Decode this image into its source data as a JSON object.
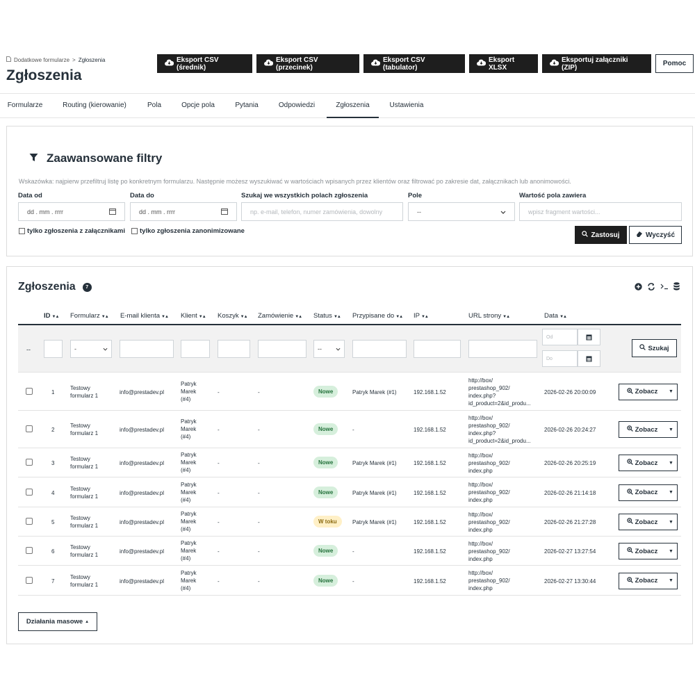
{
  "header": {
    "breadcrumb_parent": "Dodatkowe formularze",
    "breadcrumb_sep": ">",
    "breadcrumb_current": "Zgłoszenia",
    "title": "Zgłoszenia"
  },
  "toolbar": {
    "csv_avg": "Eksport CSV (średnik)",
    "csv_comma": "Eksport CSV (przecinek)",
    "csv_tab": "Eksport CSV (tabulator)",
    "xlsx": "Eksport XLSX",
    "zip": "Eksportuj załączniki (ZIP)",
    "help": "Pomoc"
  },
  "tabs": [
    "Formularze",
    "Routing (kierowanie)",
    "Pola",
    "Opcje pola",
    "Pytania",
    "Odpowiedzi",
    "Zgłoszenia",
    "Ustawienia"
  ],
  "active_tab": "Zgłoszenia",
  "filters": {
    "title": "Zaawansowane filtry",
    "hint": "Wskazówka: najpierw przefiltruj listę po konkretnym formularzu. Następnie możesz wyszukiwać w wartościach wpisanych przez klientów oraz filtrować po zakresie dat, załącznikach lub anonimowości.",
    "date_from_label": "Data od",
    "date_from_value": "dd . mm . rrrr",
    "date_to_label": "Data do",
    "date_to_value": "dd . mm . rrrr",
    "search_label": "Szukaj we wszystkich polach zgłoszenia",
    "search_placeholder": "np. e-mail, telefon, numer zamówienia, dowolny",
    "field_label": "Pole",
    "field_value": "--",
    "value_label": "Wartość pola zawiera",
    "value_placeholder": "wpisz fragment wartości...",
    "only_attachments": "tylko zgłoszenia z załącznikami",
    "only_anonymized": "tylko zgłoszenia zanonimizowane",
    "apply": "Zastosuj",
    "clear": "Wyczyść"
  },
  "list": {
    "title": "Zgłoszenia",
    "count": "7",
    "columns": [
      "ID",
      "Formularz",
      "E-mail klienta",
      "Klient",
      "Koszyk",
      "Zamówienie",
      "Status",
      "Przypisane do",
      "IP",
      "URL strony",
      "Data"
    ],
    "filter_bulk": "--",
    "filter_form": "-",
    "filter_status": "--",
    "date_from_ph": "Od",
    "date_to_ph": "Do",
    "search_btn": "Szukaj",
    "view_btn": "Zobacz",
    "bulk_actions": "Działania masowe",
    "rows": [
      {
        "id": "1",
        "form": [
          "Testowy",
          "formularz 1"
        ],
        "email": "info@prestadev.pl",
        "client": [
          "Patryk",
          "Marek",
          "(#4)"
        ],
        "cart": "-",
        "order": "-",
        "status": "Nowe",
        "assigned": "Patryk Marek (#1)",
        "ip": "192.168.1.52",
        "url": [
          "http://box/",
          "prestashop_902/",
          "index.php?",
          "id_product=2&id_produ..."
        ],
        "date": "2026-02-26 20:00:09"
      },
      {
        "id": "2",
        "form": [
          "Testowy",
          "formularz 1"
        ],
        "email": "info@prestadev.pl",
        "client": [
          "Patryk",
          "Marek",
          "(#4)"
        ],
        "cart": "-",
        "order": "-",
        "status": "Nowe",
        "assigned": "-",
        "ip": "192.168.1.52",
        "url": [
          "http://box/",
          "prestashop_902/",
          "index.php?",
          "id_product=2&id_produ..."
        ],
        "date": "2026-02-26 20:24:27"
      },
      {
        "id": "3",
        "form": [
          "Testowy",
          "formularz 1"
        ],
        "email": "info@prestadev.pl",
        "client": [
          "Patryk",
          "Marek",
          "(#4)"
        ],
        "cart": "-",
        "order": "-",
        "status": "Nowe",
        "assigned": "Patryk Marek (#1)",
        "ip": "192.168.1.52",
        "url": [
          "http://box/",
          "prestashop_902/",
          "index.php"
        ],
        "date": "2026-02-26 20:25:19"
      },
      {
        "id": "4",
        "form": [
          "Testowy",
          "formularz 1"
        ],
        "email": "info@prestadev.pl",
        "client": [
          "Patryk",
          "Marek",
          "(#4)"
        ],
        "cart": "-",
        "order": "-",
        "status": "Nowe",
        "assigned": "Patryk Marek (#1)",
        "ip": "192.168.1.52",
        "url": [
          "http://box/",
          "prestashop_902/",
          "index.php"
        ],
        "date": "2026-02-26 21:14:18"
      },
      {
        "id": "5",
        "form": [
          "Testowy",
          "formularz 1"
        ],
        "email": "info@prestadev.pl",
        "client": [
          "Patryk",
          "Marek",
          "(#4)"
        ],
        "cart": "-",
        "order": "-",
        "status": "W toku",
        "assigned": "Patryk Marek (#1)",
        "ip": "192.168.1.52",
        "url": [
          "http://box/",
          "prestashop_902/",
          "index.php"
        ],
        "date": "2026-02-26 21:27:28"
      },
      {
        "id": "6",
        "form": [
          "Testowy",
          "formularz 1"
        ],
        "email": "info@prestadev.pl",
        "client": [
          "Patryk",
          "Marek",
          "(#4)"
        ],
        "cart": "-",
        "order": "-",
        "status": "Nowe",
        "assigned": "-",
        "ip": "192.168.1.52",
        "url": [
          "http://box/",
          "prestashop_902/",
          "index.php"
        ],
        "date": "2026-02-27 13:27:54"
      },
      {
        "id": "7",
        "form": [
          "Testowy",
          "formularz 1"
        ],
        "email": "info@prestadev.pl",
        "client": [
          "Patryk",
          "Marek",
          "(#4)"
        ],
        "cart": "-",
        "order": "-",
        "status": "Nowe",
        "assigned": "-",
        "ip": "192.168.1.52",
        "url": [
          "http://box/",
          "prestashop_902/",
          "index.php"
        ],
        "date": "2026-02-27 13:30:44"
      }
    ]
  },
  "colors": {
    "dark": "#1e1e1e",
    "text": "#25303a",
    "status_new_bg": "#d6efdc",
    "status_progress_bg": "#fff0c7"
  }
}
